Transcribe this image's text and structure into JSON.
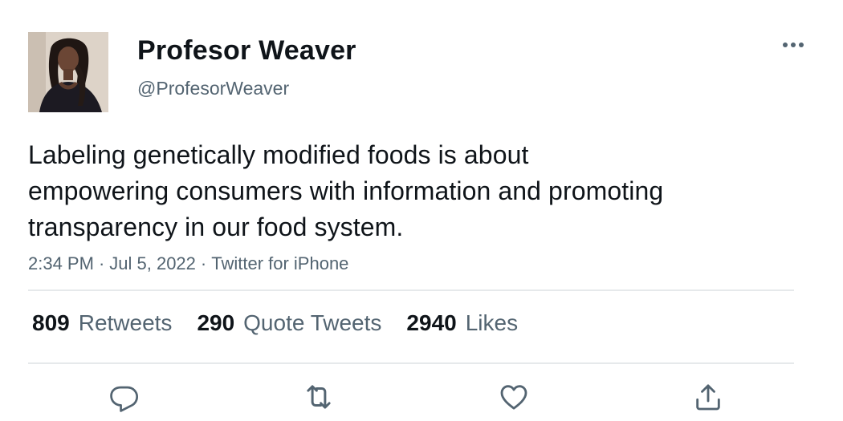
{
  "author": {
    "display_name": "Profesor Weaver",
    "handle": "@ProfesorWeaver"
  },
  "tweet": {
    "text_lines": [
      "Labeling genetically modified foods is about",
      "empowering consumers with information and promoting",
      "transparency in our food system."
    ],
    "time": "2:34 PM",
    "date": "Jul 5, 2022",
    "separator": "·",
    "source": "Twitter for iPhone"
  },
  "stats": {
    "retweets": {
      "count": "809",
      "label": "Retweets"
    },
    "quote_tweets": {
      "count": "290",
      "label": "Quote Tweets"
    },
    "likes": {
      "count": "2940",
      "label": "Likes"
    }
  },
  "actions": {
    "reply_icon": "reply-icon",
    "retweet_icon": "retweet-icon",
    "like_icon": "heart-icon",
    "share_icon": "share-icon"
  },
  "colors": {
    "text_primary": "#0f1419",
    "text_secondary": "#536471",
    "divider": "#e6e9eb"
  }
}
